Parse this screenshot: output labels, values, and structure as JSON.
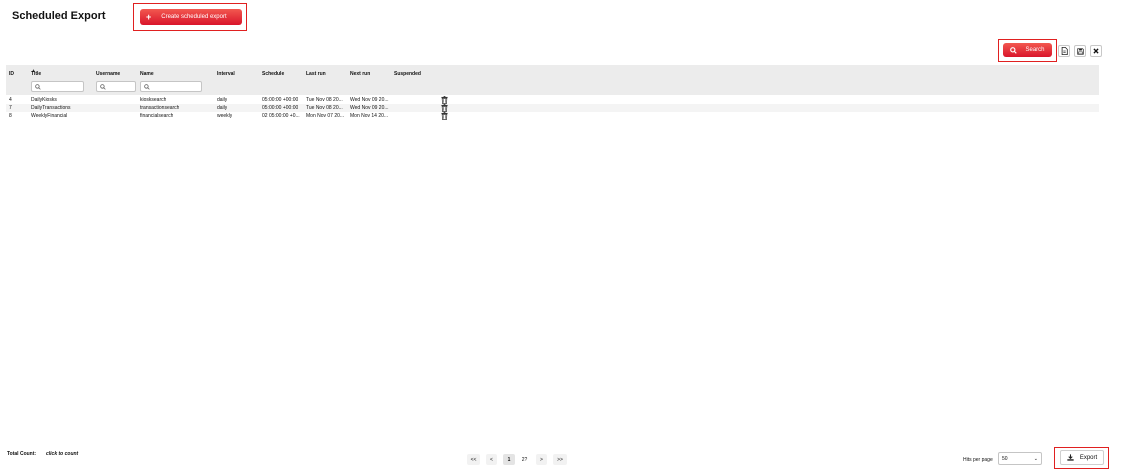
{
  "header": {
    "title": "Scheduled Export",
    "create_button_label": "Create scheduled export",
    "create_button_icon": "plus-icon"
  },
  "toolbar": {
    "search_label": "Search",
    "search_icon": "search-icon",
    "icons": [
      "document-icon",
      "save-icon",
      "close-icon"
    ]
  },
  "table": {
    "columns": [
      "ID",
      "Title",
      "Username",
      "Name",
      "Interval",
      "Schedule",
      "Last run",
      "Next run",
      "Suspended"
    ],
    "filters": [
      "Title",
      "Username",
      "Name"
    ],
    "rows": [
      {
        "id": "4",
        "title": "DailyKiosks",
        "username": "",
        "name": "kiosksearch",
        "interval": "daily",
        "schedule": "05:00:00 +00:00",
        "last_run": "Tue Nov 08 20...",
        "next_run": "Wed Nov 09 20...",
        "suspended": ""
      },
      {
        "id": "7",
        "title": "DailyTransactions",
        "username": "",
        "name": "transactionsearch",
        "interval": "daily",
        "schedule": "05:00:00 +00:00",
        "last_run": "Tue Nov 08 20...",
        "next_run": "Wed Nov 09 20...",
        "suspended": ""
      },
      {
        "id": "8",
        "title": "WeeklyFinancial",
        "username": "",
        "name": "financialsearch",
        "interval": "weekly",
        "schedule": "02 05:00:00 +0...",
        "last_run": "Mon Nov 07 20...",
        "next_run": "Mon Nov 14 20...",
        "suspended": ""
      }
    ]
  },
  "footer": {
    "total_count_label": "Total Count:",
    "click_to_count": "click to count",
    "pagination": {
      "first": "<<",
      "prev": "<",
      "current": "1",
      "next_page": "2?",
      "next": ">",
      "last": ">>"
    },
    "hits_per_page_label": "Hits per page",
    "hits_per_page_value": "50",
    "export_label": "Export"
  },
  "colors": {
    "accent": "#e0192f",
    "highlight": "#e02020",
    "header_bg": "#ececec"
  }
}
